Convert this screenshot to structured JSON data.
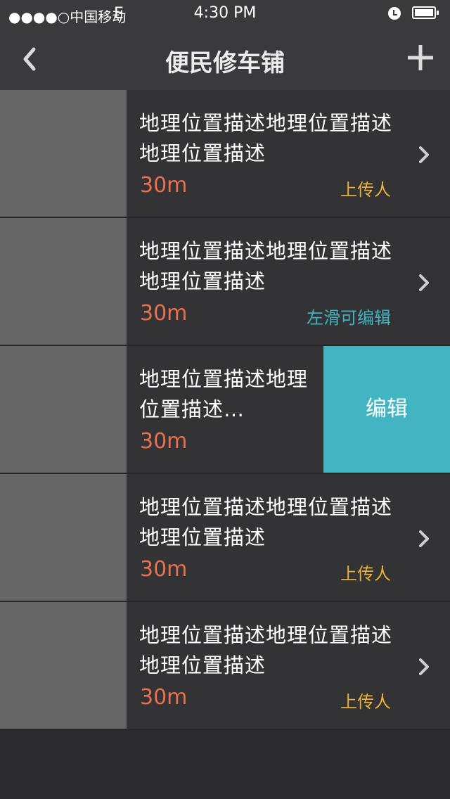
{
  "status_bar": {
    "carrier": "●●●●○中国移动",
    "network": "E",
    "time": "4:30 PM"
  },
  "nav": {
    "title": "便民修车铺"
  },
  "edit_label": "编辑",
  "items": [
    {
      "description": "地理位置描述地理位置描述地理位置描述",
      "distance": "30m",
      "tag": "上传人",
      "tag_color": "#e8b23a"
    },
    {
      "description": "地理位置描述地理位置描述地理位置描述",
      "distance": "30m",
      "tag": "左滑可编辑",
      "tag_color": "#42b2c0"
    },
    {
      "description": "地理位置描述地理位置描述…",
      "distance": "30m",
      "tag": "",
      "tag_color": ""
    },
    {
      "description": "地理位置描述地理位置描述地理位置描述",
      "distance": "30m",
      "tag": "上传人",
      "tag_color": "#e8b23a"
    },
    {
      "description": "地理位置描述地理位置描述地理位置描述",
      "distance": "30m",
      "tag": "上传人",
      "tag_color": "#e8b23a"
    }
  ]
}
